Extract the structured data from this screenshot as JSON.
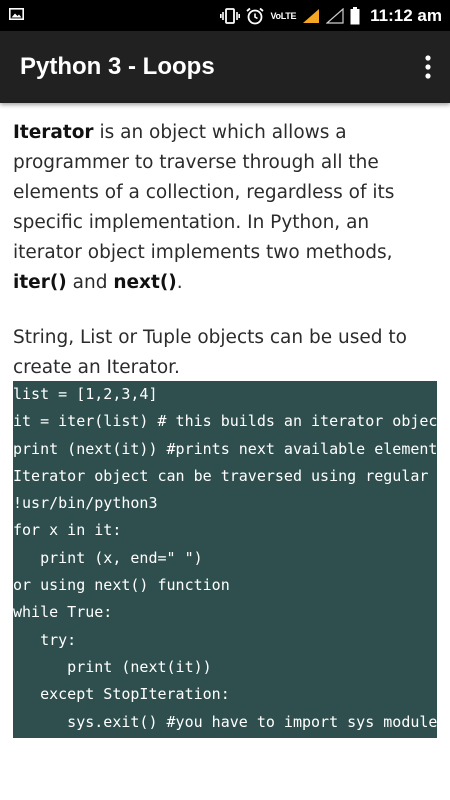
{
  "status_bar": {
    "network_label": "VoLTE",
    "time": "11:12 am"
  },
  "app_bar": {
    "title": "Python 3 - Loops",
    "menu_icon": "more-vert-icon"
  },
  "content": {
    "paragraph1": [
      {
        "text": "Iterator",
        "bold": true
      },
      {
        "text": " is an object which allows a programmer to traverse through all the elements of a collection, regardless of its specific implementation. In Python, an iterator object implements two methods, ",
        "bold": false
      },
      {
        "text": "iter()",
        "bold": true
      },
      {
        "text": " and ",
        "bold": false
      },
      {
        "text": "next()",
        "bold": true
      },
      {
        "text": ".",
        "bold": false
      }
    ],
    "paragraph2": "String, List or Tuple objects can be used to create an Iterator."
  },
  "code": {
    "lines": [
      "list = [1,2,3,4]",
      "it = iter(list) # this builds an iterator object",
      "print (next(it)) #prints next available element in iterator",
      "Iterator object can be traversed using regular for statement",
      "!usr/bin/python3",
      "for x in it:",
      "   print (x, end=\" \")",
      "or using next() function",
      "while True:",
      "   try:",
      "      print (next(it))",
      "   except StopIteration:",
      "      sys.exit() #you have to import sys module for this"
    ]
  },
  "colors": {
    "status_bar": "#000000",
    "app_bar": "#212121",
    "code_background": "#2f4f4f",
    "warning_triangle": "#f5a623"
  }
}
